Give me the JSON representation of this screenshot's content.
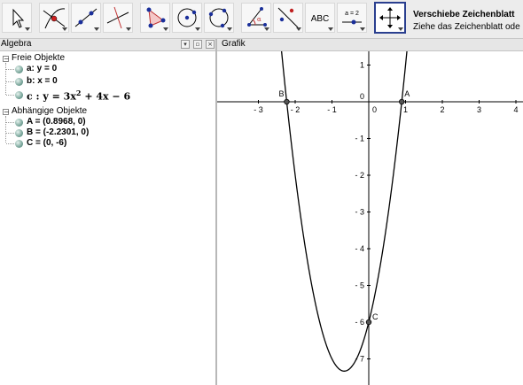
{
  "toolbar": {
    "tools": [
      {
        "name": "move-tool-button",
        "icon": "pointer-icon"
      },
      {
        "name": "new-point-tool-button",
        "icon": "intersect-point-icon"
      },
      {
        "name": "line-tool-button",
        "icon": "line-through-points-icon"
      },
      {
        "name": "perpendicular-tool-button",
        "icon": "perpendicular-line-icon"
      },
      {
        "name": "polygon-tool-button",
        "icon": "polygon-icon"
      },
      {
        "name": "circle-tool-button",
        "icon": "circle-center-point-icon"
      },
      {
        "name": "circle-three-points-tool-button",
        "icon": "circle-three-points-icon"
      },
      {
        "name": "angle-tool-button",
        "icon": "angle-icon"
      },
      {
        "name": "reflect-tool-button",
        "icon": "reflect-icon"
      },
      {
        "name": "text-tool-button",
        "icon": "text-icon",
        "label": "ABC"
      },
      {
        "name": "slider-tool-button",
        "icon": "slider-icon",
        "label": "a = 2"
      },
      {
        "name": "move-graphics-view-tool-button",
        "icon": "move-view-icon",
        "active": true
      }
    ],
    "active_tool_title": "Verschiebe Zeichenblatt",
    "active_tool_help": "Ziehe das Zeichenblatt ode"
  },
  "algebra": {
    "title": "Algebra",
    "free_category": "Freie Objekte",
    "dependent_category": "Abhängige Objekte",
    "free_objects": [
      {
        "text": "a: y = 0"
      },
      {
        "text": "b: x = 0"
      }
    ],
    "function_object": {
      "name": "c : y = 3x",
      "exp": "2",
      "rest": " + 4x − 6"
    },
    "dependent_objects": [
      {
        "text": "A = (0.8968, 0)"
      },
      {
        "text": "B = (-2.2301, 0)"
      },
      {
        "text": "C = (0, -6)"
      }
    ]
  },
  "graphics": {
    "title": "Grafik"
  },
  "colors": {
    "curve": "#000000",
    "axis": "#000000",
    "active_border": "#2a3f8f",
    "point_fill": "#555555"
  },
  "chart_data": {
    "type": "line",
    "function": "3x^2 + 4x - 6",
    "coefficients": {
      "a": 3,
      "b": 4,
      "c": -6
    },
    "xlim": [
      -4.35,
      4.35
    ],
    "ylim": [
      -7.55,
      1.5
    ],
    "x_ticks": [
      -3,
      -2,
      -1,
      1,
      2,
      3,
      4
    ],
    "y_ticks": [
      1,
      -1,
      -2,
      -3,
      -4,
      -5,
      -6,
      -7
    ],
    "origin_label": "0",
    "points": [
      {
        "label": "A",
        "x": 0.8968,
        "y": 0
      },
      {
        "label": "B",
        "x": -2.2301,
        "y": 0
      },
      {
        "label": "C",
        "x": 0,
        "y": -6
      }
    ]
  }
}
